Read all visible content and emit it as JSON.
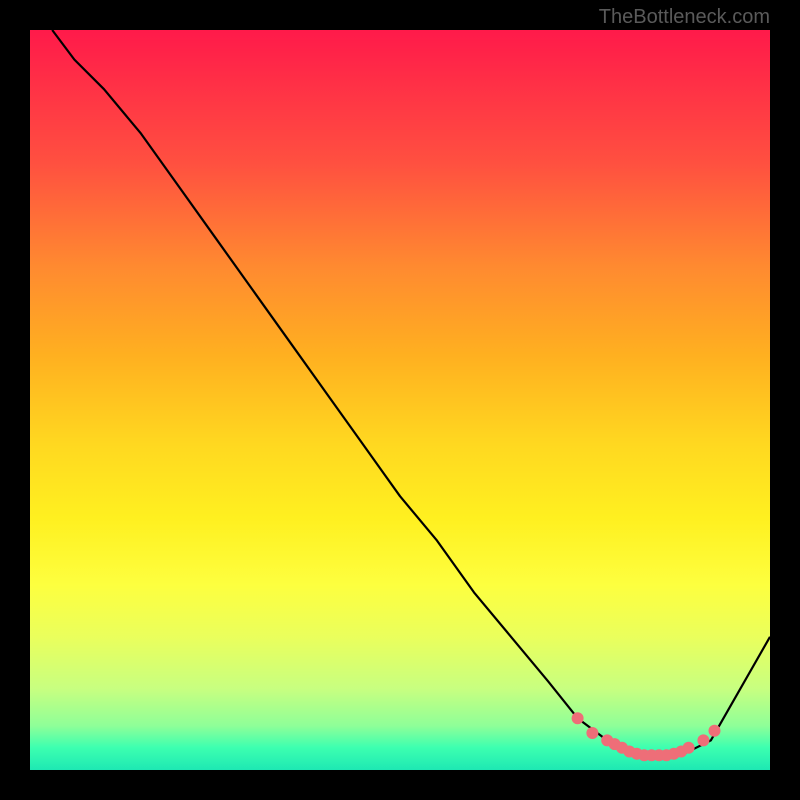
{
  "attribution": "TheBottleneck.com",
  "chart_data": {
    "type": "line",
    "title": "",
    "xlabel": "",
    "ylabel": "",
    "xlim": [
      0,
      100
    ],
    "ylim": [
      0,
      100
    ],
    "series": [
      {
        "name": "curve",
        "x": [
          3,
          6,
          10,
          15,
          20,
          25,
          30,
          35,
          40,
          45,
          50,
          55,
          60,
          65,
          70,
          74,
          78,
          80,
          82,
          84,
          86,
          88,
          90,
          92,
          100
        ],
        "y": [
          100,
          96,
          92,
          86,
          79,
          72,
          65,
          58,
          51,
          44,
          37,
          31,
          24,
          18,
          12,
          7,
          4,
          3,
          2,
          2,
          2,
          2,
          3,
          4,
          18
        ],
        "color": "#000000"
      }
    ],
    "dots": {
      "name": "highlight-dots",
      "points": [
        {
          "x": 74,
          "y": 7
        },
        {
          "x": 76,
          "y": 5
        },
        {
          "x": 78,
          "y": 4
        },
        {
          "x": 79,
          "y": 3.5
        },
        {
          "x": 80,
          "y": 3
        },
        {
          "x": 81,
          "y": 2.5
        },
        {
          "x": 82,
          "y": 2.2
        },
        {
          "x": 83,
          "y": 2
        },
        {
          "x": 84,
          "y": 2
        },
        {
          "x": 85,
          "y": 2
        },
        {
          "x": 86,
          "y": 2
        },
        {
          "x": 87,
          "y": 2.2
        },
        {
          "x": 88,
          "y": 2.5
        },
        {
          "x": 89,
          "y": 3
        },
        {
          "x": 91,
          "y": 4
        },
        {
          "x": 92.5,
          "y": 5.3
        }
      ],
      "color": "#ee6e78"
    }
  }
}
